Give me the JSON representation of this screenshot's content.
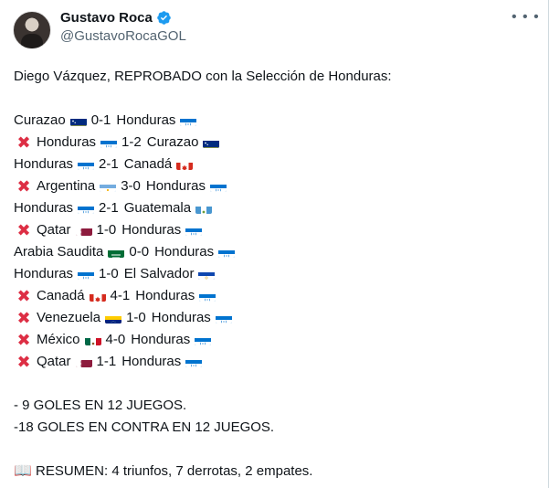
{
  "author": {
    "name": "Gustavo Roca",
    "handle": "@GustavoRocaGOL"
  },
  "menu_icon": "more-horizontal-icon",
  "tweet": {
    "heading": "Diego Vázquez, REPROBADO con la Selección de Honduras:",
    "matches": [
      {
        "lost": false,
        "home": "Curazao",
        "home_flag": "curacao",
        "score": "0-1",
        "away": "Honduras",
        "away_flag": "honduras"
      },
      {
        "lost": true,
        "home": "Honduras",
        "home_flag": "honduras",
        "score": "1-2",
        "away": "Curazao",
        "away_flag": "curacao"
      },
      {
        "lost": false,
        "home": "Honduras",
        "home_flag": "honduras",
        "score": "2-1",
        "away": "Canadá",
        "away_flag": "canada"
      },
      {
        "lost": true,
        "home": "Argentina",
        "home_flag": "argentina",
        "score": "3-0",
        "away": "Honduras",
        "away_flag": "honduras"
      },
      {
        "lost": false,
        "home": "Honduras",
        "home_flag": "honduras",
        "score": "2-1",
        "away": "Guatemala",
        "away_flag": "guatemala"
      },
      {
        "lost": true,
        "home": "Qatar",
        "home_flag": "qatar",
        "score": "1-0",
        "away": "Honduras",
        "away_flag": "honduras"
      },
      {
        "lost": false,
        "home": "Arabia Saudita",
        "home_flag": "saudi",
        "score": "0-0",
        "away": "Honduras",
        "away_flag": "honduras"
      },
      {
        "lost": false,
        "home": "Honduras",
        "home_flag": "honduras",
        "score": "1-0",
        "away": "El Salvador",
        "away_flag": "elsalvador"
      },
      {
        "lost": true,
        "home": "Canadá",
        "home_flag": "canada",
        "score": "4-1",
        "away": "Honduras",
        "away_flag": "honduras"
      },
      {
        "lost": true,
        "home": "Venezuela",
        "home_flag": "venezuela",
        "score": "1-0",
        "away": "Honduras",
        "away_flag": "honduras"
      },
      {
        "lost": true,
        "home": "México",
        "home_flag": "mexico",
        "score": "4-0",
        "away": "Honduras",
        "away_flag": "honduras"
      },
      {
        "lost": true,
        "home": "Qatar",
        "home_flag": "qatar",
        "score": "1-1",
        "away": "Honduras",
        "away_flag": "honduras"
      }
    ],
    "stats": [
      "- 9 GOLES EN 12 JUEGOS.",
      "-18 GOLES EN CONTRA EN 12 JUEGOS."
    ],
    "summary": "RESUMEN: 4 triunfos, 7 derrotas, 2 empates."
  },
  "colors": {
    "loss_x": "#dd2e44",
    "verified": "#1d9bf0",
    "secondary": "#536471"
  }
}
